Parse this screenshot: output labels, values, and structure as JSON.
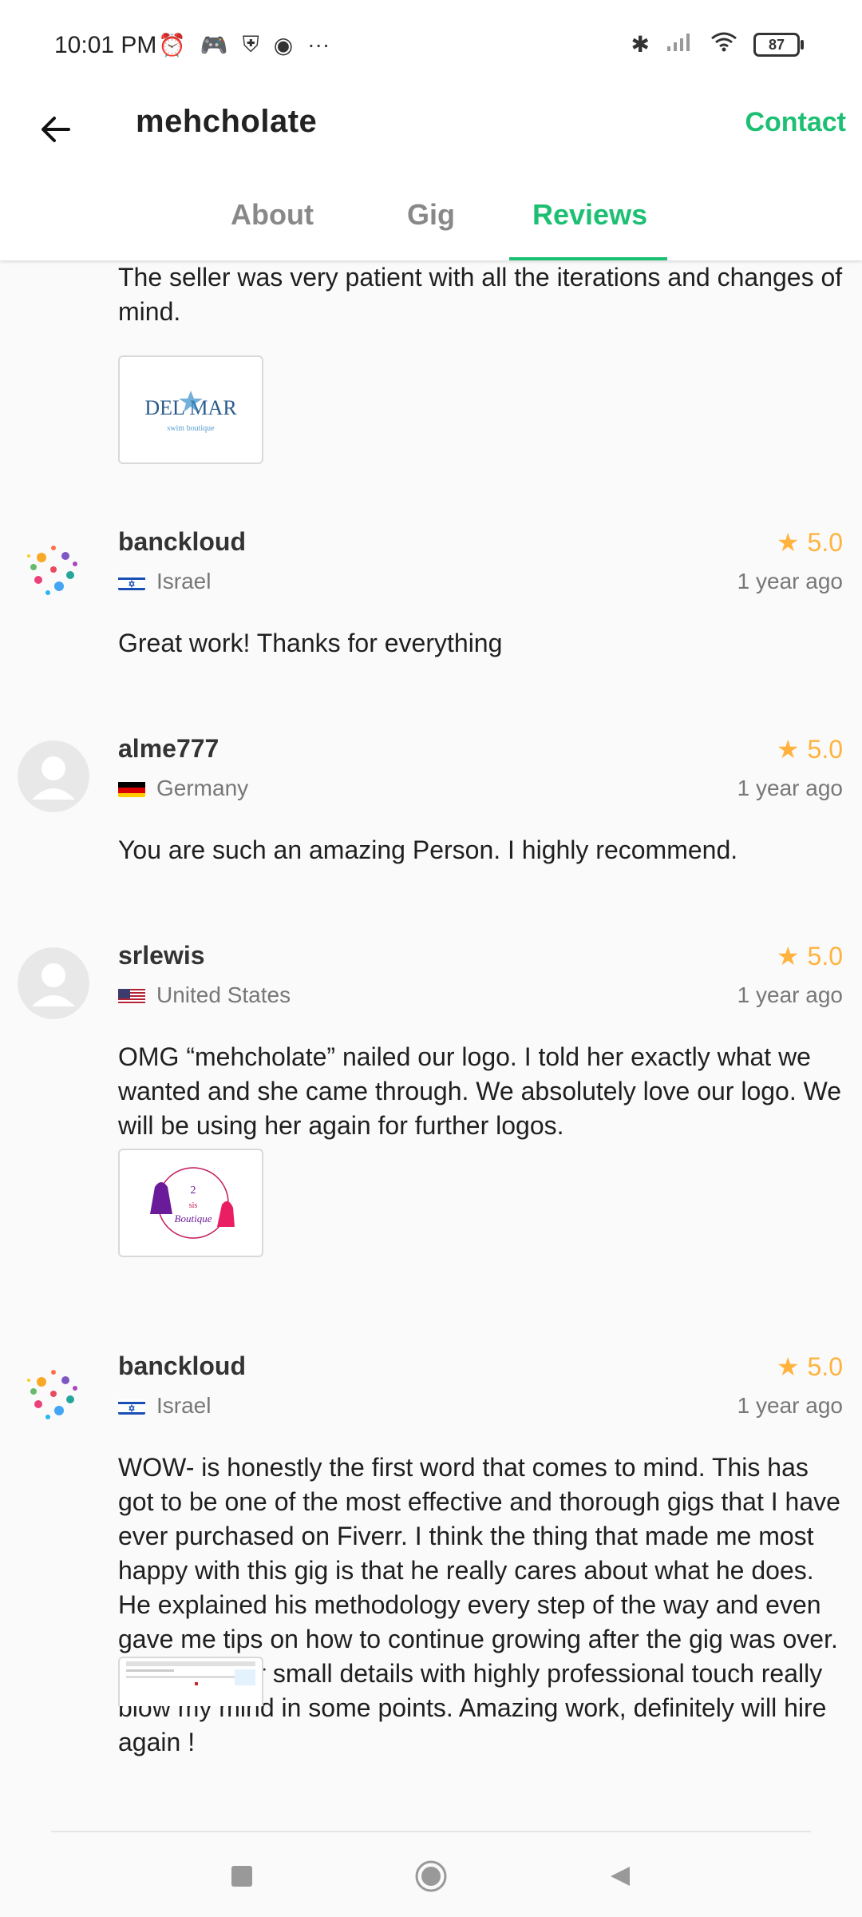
{
  "status_bar": {
    "time": "10:01 PM",
    "left_icons": [
      "alarm-icon",
      "gamepad-icon",
      "shield-icon",
      "music-icon",
      "more-icon"
    ],
    "battery": "87",
    "right_icons": [
      "bluetooth-icon",
      "signal-icon",
      "wifi-icon",
      "battery-icon"
    ]
  },
  "header": {
    "title": "mehcholate",
    "contact_label": "Contact",
    "back_icon": "back-arrow-icon"
  },
  "tabs": [
    {
      "label": "About",
      "active": false
    },
    {
      "label": "Gig",
      "active": false
    },
    {
      "label": "Reviews",
      "active": true
    }
  ],
  "top_review": {
    "text": "The seller was very patient with all the iterations and changes of mind.",
    "attachment": {
      "logo_main": "DEL MAR",
      "logo_sub": "swim boutique"
    }
  },
  "reviews": [
    {
      "username": "banckloud",
      "country": "Israel",
      "flag": "israel",
      "rating": "5.0",
      "time": "1 year ago",
      "text": "Great work! Thanks for everything",
      "avatar": "colorful"
    },
    {
      "username": "alme777",
      "country": "Germany",
      "flag": "germany",
      "rating": "5.0",
      "time": "1 year ago",
      "text": "You are such an amazing Person. I highly recommend.",
      "avatar": "default"
    },
    {
      "username": "srlewis",
      "country": "United States",
      "flag": "usa",
      "rating": "5.0",
      "time": "1 year ago",
      "text": "OMG “mehcholate” nailed our logo. I told her exactly what we wanted and she came through. We absolutely love our logo. We will be using her again for further logos.",
      "avatar": "default",
      "attachment": {
        "line1": "2",
        "line2": "sis",
        "line3": "Boutique"
      }
    },
    {
      "username": "banckloud",
      "country": "Israel",
      "flag": "israel",
      "rating": "5.0",
      "time": "1 year ago",
      "text": "WOW- is honestly the first word that comes to mind. This has got to be one of the most effective and thorough gigs that I have ever purchased on Fiverr. I think the thing that made me most happy with this gig is that he really cares about what he does. He explained his methodology every step of the way and even gave me tips on how to continue growing after the gig was over. the notice for small details with highly professional touch really blow my mind in some points. Amazing work, definitely will hire again !",
      "avatar": "colorful"
    }
  ],
  "nav_bar": {
    "buttons": [
      "recents-button",
      "home-button",
      "back-button"
    ]
  },
  "colors": {
    "accent": "#1dbf73",
    "star": "#ffb33e"
  }
}
